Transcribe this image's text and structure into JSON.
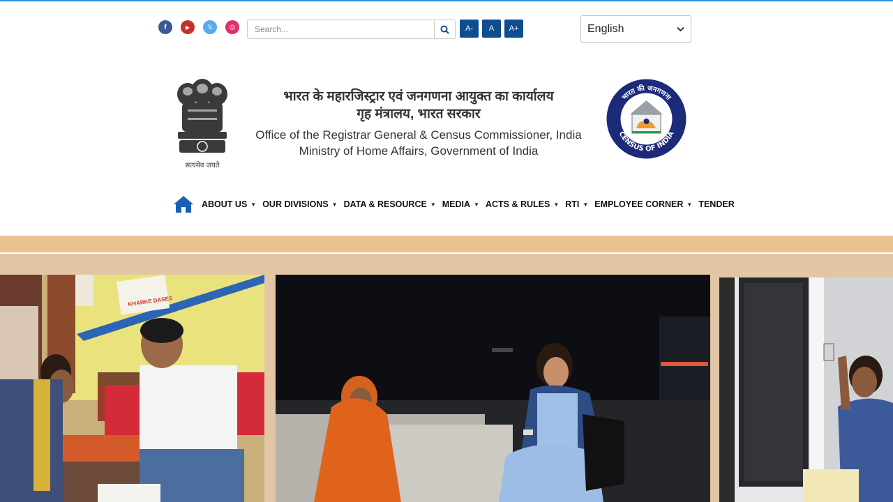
{
  "social": {
    "facebook_glyph": "f",
    "youtube_glyph": "▶",
    "twitter_glyph": "𝕏",
    "instagram_glyph": "◎"
  },
  "search": {
    "placeholder": "Search..."
  },
  "font_controls": {
    "decrease": "A-",
    "normal": "A",
    "increase": "A+"
  },
  "language": {
    "selected": "English"
  },
  "header": {
    "title_hindi_1": "भारत के महारजिस्ट्रार एवं जनगणना आयुक्त का कार्यालय",
    "title_hindi_2": "गृह मंत्रालय, भारत सरकार",
    "title_english_1": "Office of the Registrar General & Census Commissioner, India",
    "title_english_2": "Ministry of Home Affairs, Government of India",
    "emblem_motto": "सत्यमेव जयते",
    "census_logo_top": "भारत की जनगणना",
    "census_logo_bottom": "CENSUS OF INDIA"
  },
  "nav": {
    "items": [
      {
        "label": "ABOUT US"
      },
      {
        "label": "OUR DIVISIONS"
      },
      {
        "label": "DATA & RESOURCE"
      },
      {
        "label": "MEDIA"
      },
      {
        "label": "ACTS & RULES"
      },
      {
        "label": "RTI"
      },
      {
        "label": "EMPLOYEE CORNER"
      },
      {
        "label": "TENDER"
      }
    ]
  },
  "banner": {
    "poster_text": "KHARKE DASES"
  },
  "colors": {
    "accent_blue": "#0e4d8f",
    "band": "#e3c6a6",
    "stripe": "#e9c38f"
  }
}
